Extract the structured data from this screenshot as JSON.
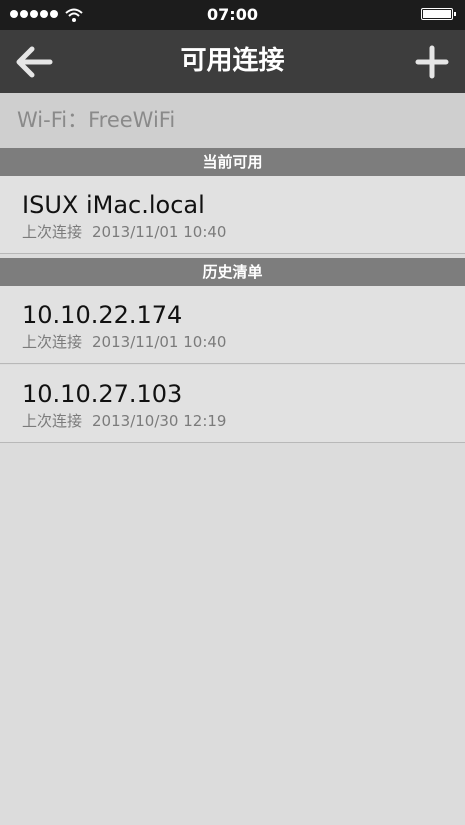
{
  "status_bar": {
    "time": "07:00"
  },
  "nav": {
    "title": "可用连接",
    "back_icon": "back-arrow-icon",
    "add_icon": "plus-icon"
  },
  "wifi": {
    "label": "Wi-Fi：FreeWiFi"
  },
  "sections": {
    "current": {
      "header": "当前可用",
      "items": [
        {
          "name": "ISUX iMac.local",
          "last_label": "上次连接",
          "last_time": "2013/11/01 10:40"
        }
      ]
    },
    "history": {
      "header": "历史清单",
      "items": [
        {
          "name": "10.10.22.174",
          "last_label": "上次连接",
          "last_time": "2013/11/01 10:40"
        },
        {
          "name": "10.10.27.103",
          "last_label": "上次连接",
          "last_time": "2013/10/30 12:19"
        }
      ]
    }
  },
  "colors": {
    "status_bar_bg": "#1c1c1c",
    "nav_bg": "#3d3d3d",
    "section_header_bg": "#7d7d7d",
    "list_bg": "#e1e1e1",
    "page_bg": "#dcdcdc"
  }
}
